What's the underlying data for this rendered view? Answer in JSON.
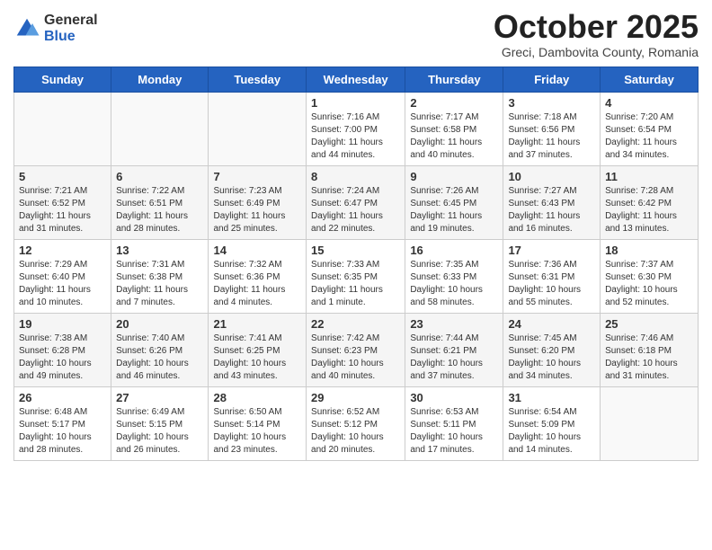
{
  "logo": {
    "general": "General",
    "blue": "Blue"
  },
  "header": {
    "month": "October 2025",
    "location": "Greci, Dambovita County, Romania"
  },
  "days_of_week": [
    "Sunday",
    "Monday",
    "Tuesday",
    "Wednesday",
    "Thursday",
    "Friday",
    "Saturday"
  ],
  "weeks": [
    [
      {
        "day": "",
        "info": ""
      },
      {
        "day": "",
        "info": ""
      },
      {
        "day": "",
        "info": ""
      },
      {
        "day": "1",
        "info": "Sunrise: 7:16 AM\nSunset: 7:00 PM\nDaylight: 11 hours and 44 minutes."
      },
      {
        "day": "2",
        "info": "Sunrise: 7:17 AM\nSunset: 6:58 PM\nDaylight: 11 hours and 40 minutes."
      },
      {
        "day": "3",
        "info": "Sunrise: 7:18 AM\nSunset: 6:56 PM\nDaylight: 11 hours and 37 minutes."
      },
      {
        "day": "4",
        "info": "Sunrise: 7:20 AM\nSunset: 6:54 PM\nDaylight: 11 hours and 34 minutes."
      }
    ],
    [
      {
        "day": "5",
        "info": "Sunrise: 7:21 AM\nSunset: 6:52 PM\nDaylight: 11 hours and 31 minutes."
      },
      {
        "day": "6",
        "info": "Sunrise: 7:22 AM\nSunset: 6:51 PM\nDaylight: 11 hours and 28 minutes."
      },
      {
        "day": "7",
        "info": "Sunrise: 7:23 AM\nSunset: 6:49 PM\nDaylight: 11 hours and 25 minutes."
      },
      {
        "day": "8",
        "info": "Sunrise: 7:24 AM\nSunset: 6:47 PM\nDaylight: 11 hours and 22 minutes."
      },
      {
        "day": "9",
        "info": "Sunrise: 7:26 AM\nSunset: 6:45 PM\nDaylight: 11 hours and 19 minutes."
      },
      {
        "day": "10",
        "info": "Sunrise: 7:27 AM\nSunset: 6:43 PM\nDaylight: 11 hours and 16 minutes."
      },
      {
        "day": "11",
        "info": "Sunrise: 7:28 AM\nSunset: 6:42 PM\nDaylight: 11 hours and 13 minutes."
      }
    ],
    [
      {
        "day": "12",
        "info": "Sunrise: 7:29 AM\nSunset: 6:40 PM\nDaylight: 11 hours and 10 minutes."
      },
      {
        "day": "13",
        "info": "Sunrise: 7:31 AM\nSunset: 6:38 PM\nDaylight: 11 hours and 7 minutes."
      },
      {
        "day": "14",
        "info": "Sunrise: 7:32 AM\nSunset: 6:36 PM\nDaylight: 11 hours and 4 minutes."
      },
      {
        "day": "15",
        "info": "Sunrise: 7:33 AM\nSunset: 6:35 PM\nDaylight: 11 hours and 1 minute."
      },
      {
        "day": "16",
        "info": "Sunrise: 7:35 AM\nSunset: 6:33 PM\nDaylight: 10 hours and 58 minutes."
      },
      {
        "day": "17",
        "info": "Sunrise: 7:36 AM\nSunset: 6:31 PM\nDaylight: 10 hours and 55 minutes."
      },
      {
        "day": "18",
        "info": "Sunrise: 7:37 AM\nSunset: 6:30 PM\nDaylight: 10 hours and 52 minutes."
      }
    ],
    [
      {
        "day": "19",
        "info": "Sunrise: 7:38 AM\nSunset: 6:28 PM\nDaylight: 10 hours and 49 minutes."
      },
      {
        "day": "20",
        "info": "Sunrise: 7:40 AM\nSunset: 6:26 PM\nDaylight: 10 hours and 46 minutes."
      },
      {
        "day": "21",
        "info": "Sunrise: 7:41 AM\nSunset: 6:25 PM\nDaylight: 10 hours and 43 minutes."
      },
      {
        "day": "22",
        "info": "Sunrise: 7:42 AM\nSunset: 6:23 PM\nDaylight: 10 hours and 40 minutes."
      },
      {
        "day": "23",
        "info": "Sunrise: 7:44 AM\nSunset: 6:21 PM\nDaylight: 10 hours and 37 minutes."
      },
      {
        "day": "24",
        "info": "Sunrise: 7:45 AM\nSunset: 6:20 PM\nDaylight: 10 hours and 34 minutes."
      },
      {
        "day": "25",
        "info": "Sunrise: 7:46 AM\nSunset: 6:18 PM\nDaylight: 10 hours and 31 minutes."
      }
    ],
    [
      {
        "day": "26",
        "info": "Sunrise: 6:48 AM\nSunset: 5:17 PM\nDaylight: 10 hours and 28 minutes."
      },
      {
        "day": "27",
        "info": "Sunrise: 6:49 AM\nSunset: 5:15 PM\nDaylight: 10 hours and 26 minutes."
      },
      {
        "day": "28",
        "info": "Sunrise: 6:50 AM\nSunset: 5:14 PM\nDaylight: 10 hours and 23 minutes."
      },
      {
        "day": "29",
        "info": "Sunrise: 6:52 AM\nSunset: 5:12 PM\nDaylight: 10 hours and 20 minutes."
      },
      {
        "day": "30",
        "info": "Sunrise: 6:53 AM\nSunset: 5:11 PM\nDaylight: 10 hours and 17 minutes."
      },
      {
        "day": "31",
        "info": "Sunrise: 6:54 AM\nSunset: 5:09 PM\nDaylight: 10 hours and 14 minutes."
      },
      {
        "day": "",
        "info": ""
      }
    ]
  ]
}
